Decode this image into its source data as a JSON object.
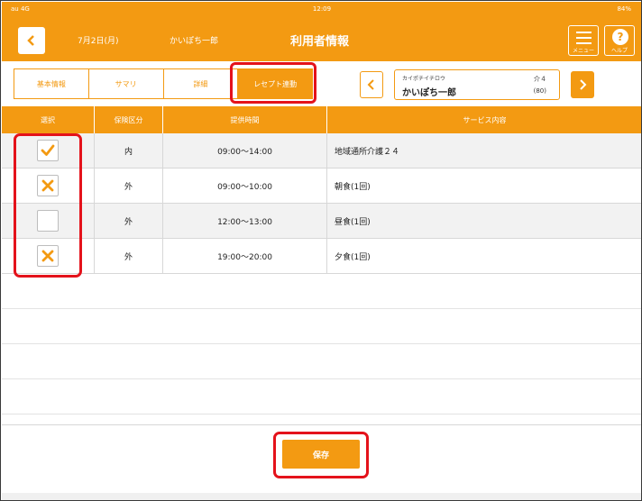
{
  "status_bar": {
    "carrier": "au 4G",
    "time": "12:09",
    "battery": "84%"
  },
  "header": {
    "date": "7月2日(月)",
    "user_name": "かいぽち一郎",
    "title": "利用者情報",
    "menu_label": "メニュー",
    "help_label": "ヘルプ"
  },
  "tabs": [
    {
      "label": "基本情報",
      "active": false
    },
    {
      "label": "サマリ",
      "active": false
    },
    {
      "label": "詳細",
      "active": false
    },
    {
      "label": "レセプト連動",
      "active": true
    }
  ],
  "patient": {
    "kana": "カイポチイチロウ",
    "name": "かいぽち一郎",
    "care_level": "介４",
    "age": "(80)"
  },
  "table": {
    "columns": [
      "選択",
      "保険区分",
      "提供時間",
      "サービス内容"
    ],
    "rows": [
      {
        "selected": "check",
        "insurance": "内",
        "time": "09:00～14:00",
        "service": "地域通所介護２４"
      },
      {
        "selected": "cross",
        "insurance": "外",
        "time": "09:00～10:00",
        "service": "朝食(1回)"
      },
      {
        "selected": "none",
        "insurance": "外",
        "time": "12:00～13:00",
        "service": "昼食(1回)"
      },
      {
        "selected": "cross",
        "insurance": "外",
        "time": "19:00～20:00",
        "service": "夕食(1回)"
      }
    ]
  },
  "footer": {
    "save_label": "保存"
  },
  "colors": {
    "accent": "#f39a12",
    "highlight": "#e4121b"
  }
}
